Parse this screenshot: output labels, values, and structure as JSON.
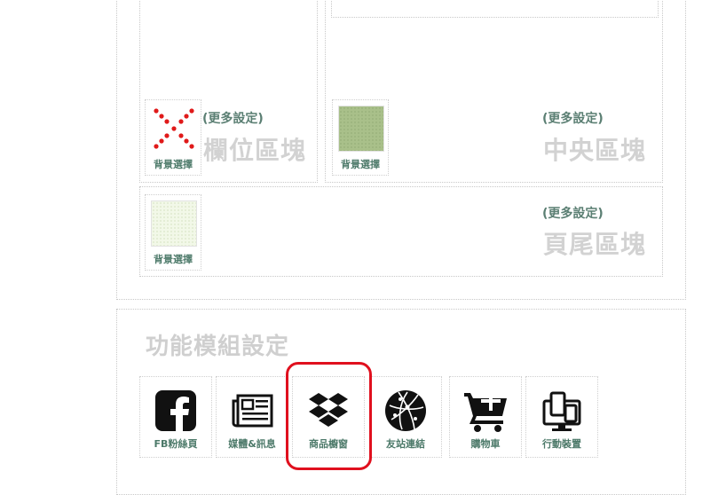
{
  "layout_blocks": {
    "sidebar_block": {
      "more_settings": "(更多設定)",
      "title": "欄位區塊",
      "bg_label": "背景選擇",
      "swatch": "none-x"
    },
    "center_block": {
      "more_settings": "(更多設定)",
      "title": "中央區塊",
      "bg_label": "背景選擇",
      "swatch_color": "#a9c08a"
    },
    "footer_block": {
      "more_settings": "(更多設定)",
      "title": "頁尾區塊",
      "bg_label": "背景選擇",
      "swatch_color": "#f2f8e8"
    }
  },
  "modules_section": {
    "title": "功能模組設定",
    "items": [
      {
        "label": "FB粉絲頁",
        "icon": "facebook-icon"
      },
      {
        "label": "媒體&訊息",
        "icon": "newspaper-icon"
      },
      {
        "label": "商品櫥窗",
        "icon": "dropbox-icon",
        "highlighted": true
      },
      {
        "label": "友站連結",
        "icon": "globe-network-icon"
      },
      {
        "label": "購物車",
        "icon": "cart-add-icon"
      },
      {
        "label": "行動裝置",
        "icon": "devices-icon"
      }
    ]
  },
  "colors": {
    "label_green": "#4d7a6a",
    "title_gray": "#d2d2d2",
    "highlight_red": "#e0101e"
  }
}
